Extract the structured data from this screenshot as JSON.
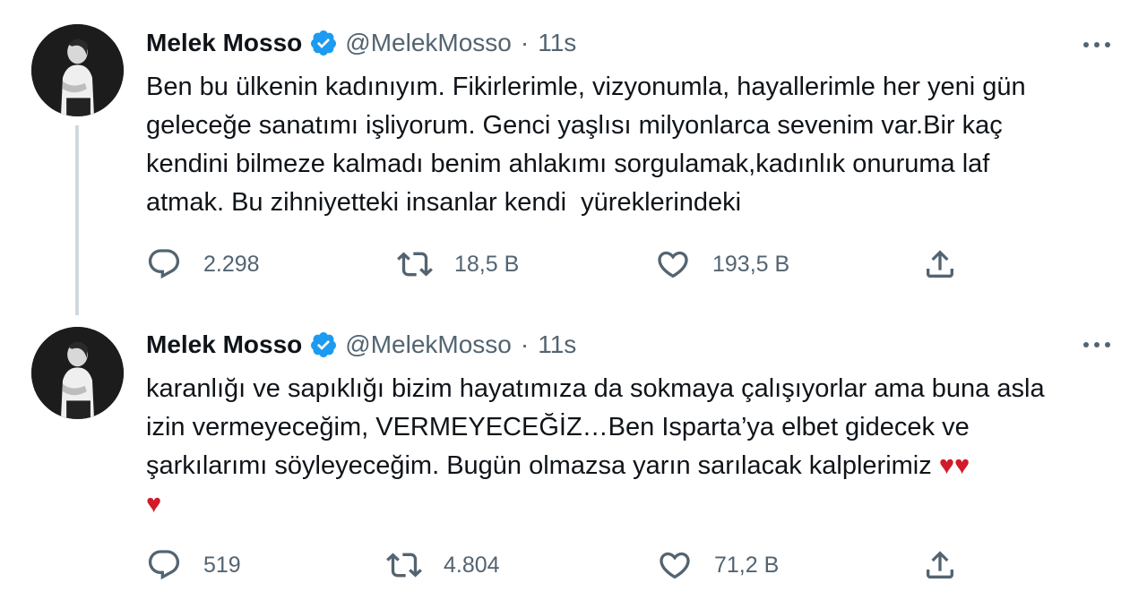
{
  "tweets": [
    {
      "author": {
        "name": "Melek Mosso",
        "handle": "@MelekMosso",
        "separator": "·",
        "time": "11s"
      },
      "text": "Ben bu ülkenin kadınıyım. Fikirlerimle, vizyonumla, hayallerimle her yeni gün\ngeleceğe sanatımı işliyorum. Genci yaşlısı milyonlarca sevenim var.Bir kaç\nkendini bilmeze kalmadı benim ahlakımı sorgulamak,kadınlık onuruma laf\natmak. Bu zihniyetteki insanlar kendi  yüreklerindeki",
      "emoji_text": "",
      "stats": {
        "replies": "2.298",
        "retweets": "18,5 B",
        "likes": "193,5 B"
      }
    },
    {
      "author": {
        "name": "Melek Mosso",
        "handle": "@MelekMosso",
        "separator": "·",
        "time": "11s"
      },
      "text": "karanlığı ve sapıklığı bizim hayatımıza da sokmaya çalışıyorlar ama buna asla\nizin vermeyeceğim, VERMEYECEĞİZ…Ben Isparta’ya elbet gidecek ve\nşarkılarımı söyleyeceğim. Bugün olmazsa yarın sarılacak kalplerimiz ",
      "emoji_text": "♥♥\n♥",
      "stats": {
        "replies": "519",
        "retweets": "4.804",
        "likes": "71,2 B"
      }
    }
  ],
  "icons": {
    "verified": "verified-badge-icon",
    "more": "more-options-icon",
    "reply": "reply-icon",
    "retweet": "retweet-icon",
    "like": "heart-icon",
    "share": "share-icon"
  },
  "colors": {
    "verified": "#1d9bf0",
    "text_secondary": "#536471",
    "heart_emoji": "#d11a2a",
    "thread_line": "#cfd9de"
  }
}
